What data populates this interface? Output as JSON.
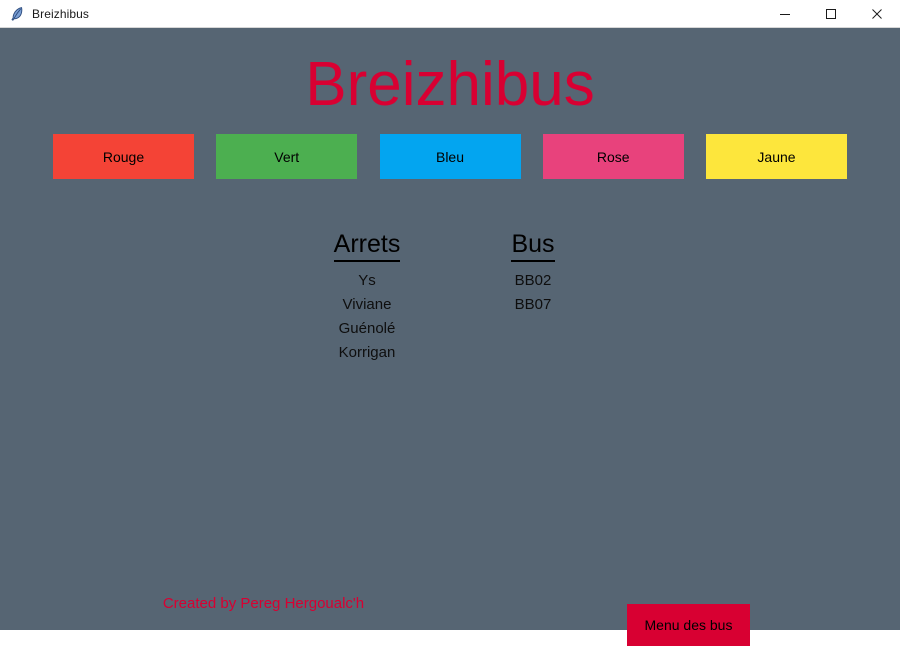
{
  "window": {
    "title": "Breizhibus",
    "icon": "feather-icon",
    "controls": {
      "minimize": "minimize-icon",
      "maximize": "maximize-icon",
      "close": "close-icon"
    }
  },
  "app": {
    "heading": "Breizhibus",
    "background_color": "#566573",
    "accent_color": "#d80032",
    "line_buttons": [
      {
        "label": "Rouge",
        "color": "#f44336",
        "name": "line-button-rouge"
      },
      {
        "label": "Vert",
        "color": "#4caf50",
        "name": "line-button-vert"
      },
      {
        "label": "Bleu",
        "color": "#03a5f0",
        "name": "line-button-bleu"
      },
      {
        "label": "Rose",
        "color": "#e8427c",
        "name": "line-button-rose"
      },
      {
        "label": "Jaune",
        "color": "#fde63c",
        "name": "line-button-jaune"
      }
    ],
    "columns": [
      {
        "header": "Arrets",
        "items": [
          "Ys",
          "Viviane",
          "Guénolé",
          "Korrigan"
        ]
      },
      {
        "header": "Bus",
        "items": [
          "BB02",
          "BB07"
        ]
      }
    ],
    "credits": "Created by Pereg Hergoualc'h",
    "menu_button": "Menu des bus"
  }
}
